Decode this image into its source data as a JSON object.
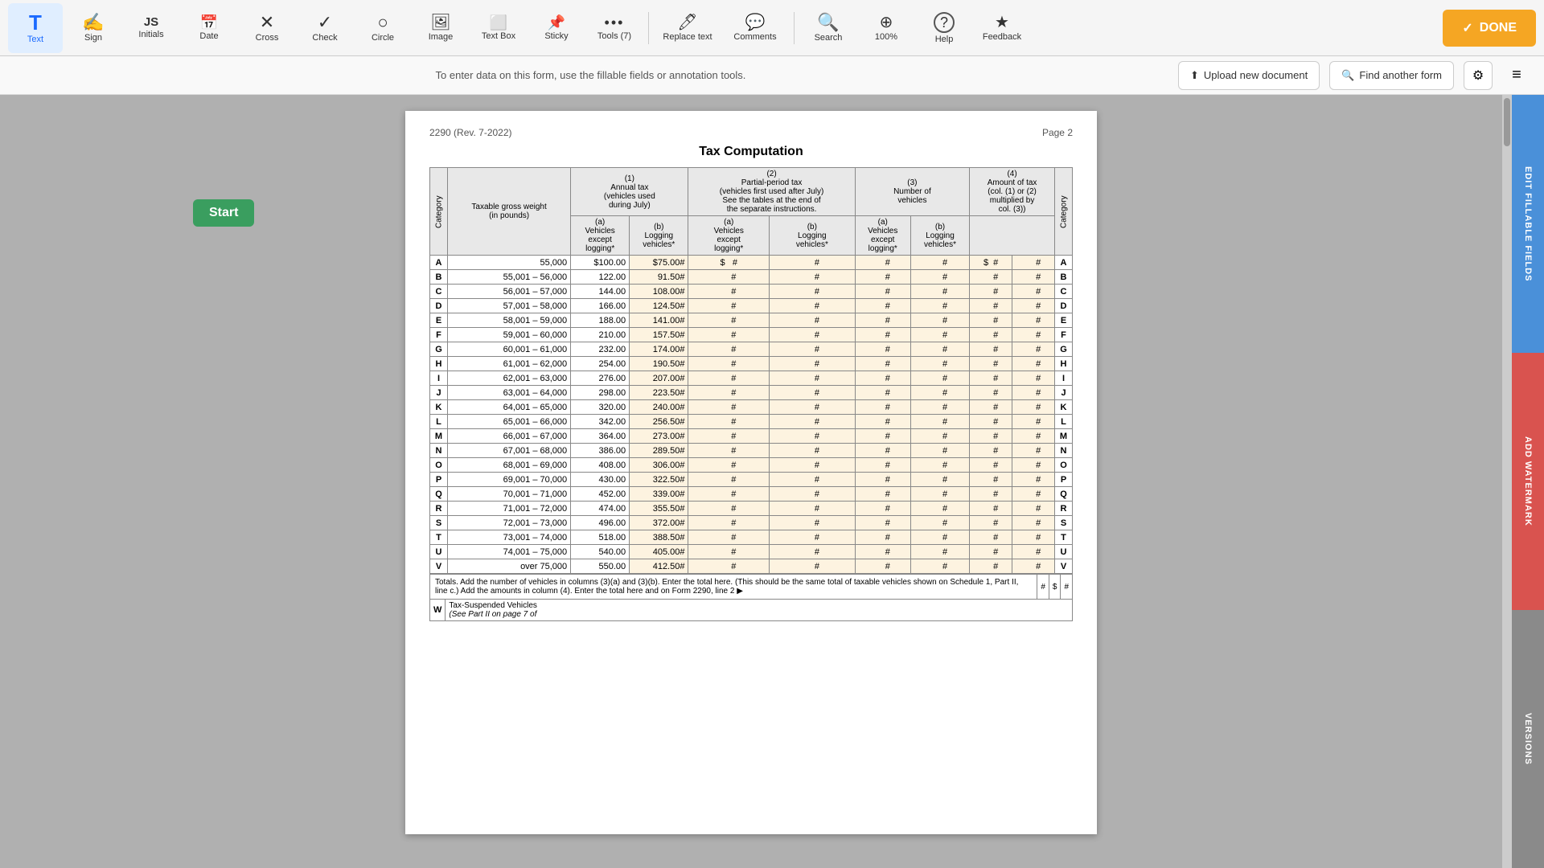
{
  "toolbar": {
    "tools": [
      {
        "id": "text",
        "label": "Text",
        "icon": "T",
        "active": true
      },
      {
        "id": "sign",
        "label": "Sign",
        "icon": "✍"
      },
      {
        "id": "initials",
        "label": "Initials",
        "icon": "JS"
      },
      {
        "id": "date",
        "label": "Date",
        "icon": "15"
      },
      {
        "id": "cross",
        "label": "Cross",
        "icon": "✕"
      },
      {
        "id": "check",
        "label": "Check",
        "icon": "✓"
      },
      {
        "id": "circle",
        "label": "Circle",
        "icon": "○"
      },
      {
        "id": "image",
        "label": "Image",
        "icon": "▣"
      },
      {
        "id": "textbox",
        "label": "Text Box",
        "icon": "⬜"
      },
      {
        "id": "sticky",
        "label": "Sticky",
        "icon": "📌"
      },
      {
        "id": "tools",
        "label": "Tools (7)",
        "icon": "•••"
      }
    ],
    "actions": [
      {
        "id": "replace-text",
        "label": "Replace text"
      },
      {
        "id": "comments",
        "label": "Comments"
      },
      {
        "id": "search",
        "label": "Search"
      },
      {
        "id": "zoom",
        "label": "100%"
      },
      {
        "id": "help",
        "label": "Help"
      },
      {
        "id": "feedback",
        "label": "Feedback"
      }
    ],
    "done_label": "DONE"
  },
  "secondary_bar": {
    "info_text": "To enter data on this form, use the fillable fields or annotation tools.",
    "upload_label": "Upload new document",
    "find_label": "Find another form"
  },
  "page": {
    "form_ref": "2290 (Rev. 7-2022)",
    "page_num": "Page 2",
    "title": "Tax Computation",
    "columns": {
      "cat": "Category",
      "col1_header": "(1)\nAnnual tax\n(vehicles used\nduring July)",
      "col2_header": "(2)\nPartial-period tax\n(vehicles first used after July)\nSee the tables at the end of\nthe separate instructions.",
      "col3_header": "(3)\nNumber of\nvehicles",
      "col4_header": "(4)\nAmount of tax\n(col. (1) or (2)\nmultiplied by\ncol. (3))",
      "sub_a": "(a)\nVehicles\nexcept\nlogging*",
      "sub_b": "(b)\nLogging\nvehicles*"
    },
    "rows": [
      {
        "letter": "A",
        "weight": "55,000",
        "col1a": "$100.00",
        "col1b": "$75.00#"
      },
      {
        "letter": "B",
        "weight": "55,001 – 56,000",
        "col1a": "122.00",
        "col1b": "91.50#"
      },
      {
        "letter": "C",
        "weight": "56,001 – 57,000",
        "col1a": "144.00",
        "col1b": "108.00#"
      },
      {
        "letter": "D",
        "weight": "57,001 – 58,000",
        "col1a": "166.00",
        "col1b": "124.50#"
      },
      {
        "letter": "E",
        "weight": "58,001 – 59,000",
        "col1a": "188.00",
        "col1b": "141.00#"
      },
      {
        "letter": "F",
        "weight": "59,001 – 60,000",
        "col1a": "210.00",
        "col1b": "157.50#"
      },
      {
        "letter": "G",
        "weight": "60,001 – 61,000",
        "col1a": "232.00",
        "col1b": "174.00#"
      },
      {
        "letter": "H",
        "weight": "61,001 – 62,000",
        "col1a": "254.00",
        "col1b": "190.50#"
      },
      {
        "letter": "I",
        "weight": "62,001 – 63,000",
        "col1a": "276.00",
        "col1b": "207.00#"
      },
      {
        "letter": "J",
        "weight": "63,001 – 64,000",
        "col1a": "298.00",
        "col1b": "223.50#"
      },
      {
        "letter": "K",
        "weight": "64,001 – 65,000",
        "col1a": "320.00",
        "col1b": "240.00#"
      },
      {
        "letter": "L",
        "weight": "65,001 – 66,000",
        "col1a": "342.00",
        "col1b": "256.50#"
      },
      {
        "letter": "M",
        "weight": "66,001 – 67,000",
        "col1a": "364.00",
        "col1b": "273.00#"
      },
      {
        "letter": "N",
        "weight": "67,001 – 68,000",
        "col1a": "386.00",
        "col1b": "289.50#"
      },
      {
        "letter": "O",
        "weight": "68,001 – 69,000",
        "col1a": "408.00",
        "col1b": "306.00#"
      },
      {
        "letter": "P",
        "weight": "69,001 – 70,000",
        "col1a": "430.00",
        "col1b": "322.50#"
      },
      {
        "letter": "Q",
        "weight": "70,001 – 71,000",
        "col1a": "452.00",
        "col1b": "339.00#"
      },
      {
        "letter": "R",
        "weight": "71,001 – 72,000",
        "col1a": "474.00",
        "col1b": "355.50#"
      },
      {
        "letter": "S",
        "weight": "72,001 – 73,000",
        "col1a": "496.00",
        "col1b": "372.00#"
      },
      {
        "letter": "T",
        "weight": "73,001 – 74,000",
        "col1a": "518.00",
        "col1b": "388.50#"
      },
      {
        "letter": "U",
        "weight": "74,001 – 75,000",
        "col1a": "540.00",
        "col1b": "405.00#"
      },
      {
        "letter": "V",
        "weight": "over 75,000",
        "col1a": "550.00",
        "col1b": "412.50#"
      }
    ],
    "totals_text": "Totals. Add the number of vehicles in columns (3)(a) and (3)(b). Enter the total here. (This should be the same total of taxable vehicles shown on Schedule 1, Part II, line c.) Add the amounts in column (4). Enter the total here and on Form 2290, line 2  ▶",
    "w_label": "W",
    "w_desc": "Tax-Suspended Vehicles\n(See Part II on page 7 of"
  },
  "side_panels": {
    "edit_label": "EDIT FILLABLE FIELDS",
    "watermark_label": "ADD WATERMARK",
    "versions_label": "VERSIONS"
  },
  "start_button": "Start"
}
